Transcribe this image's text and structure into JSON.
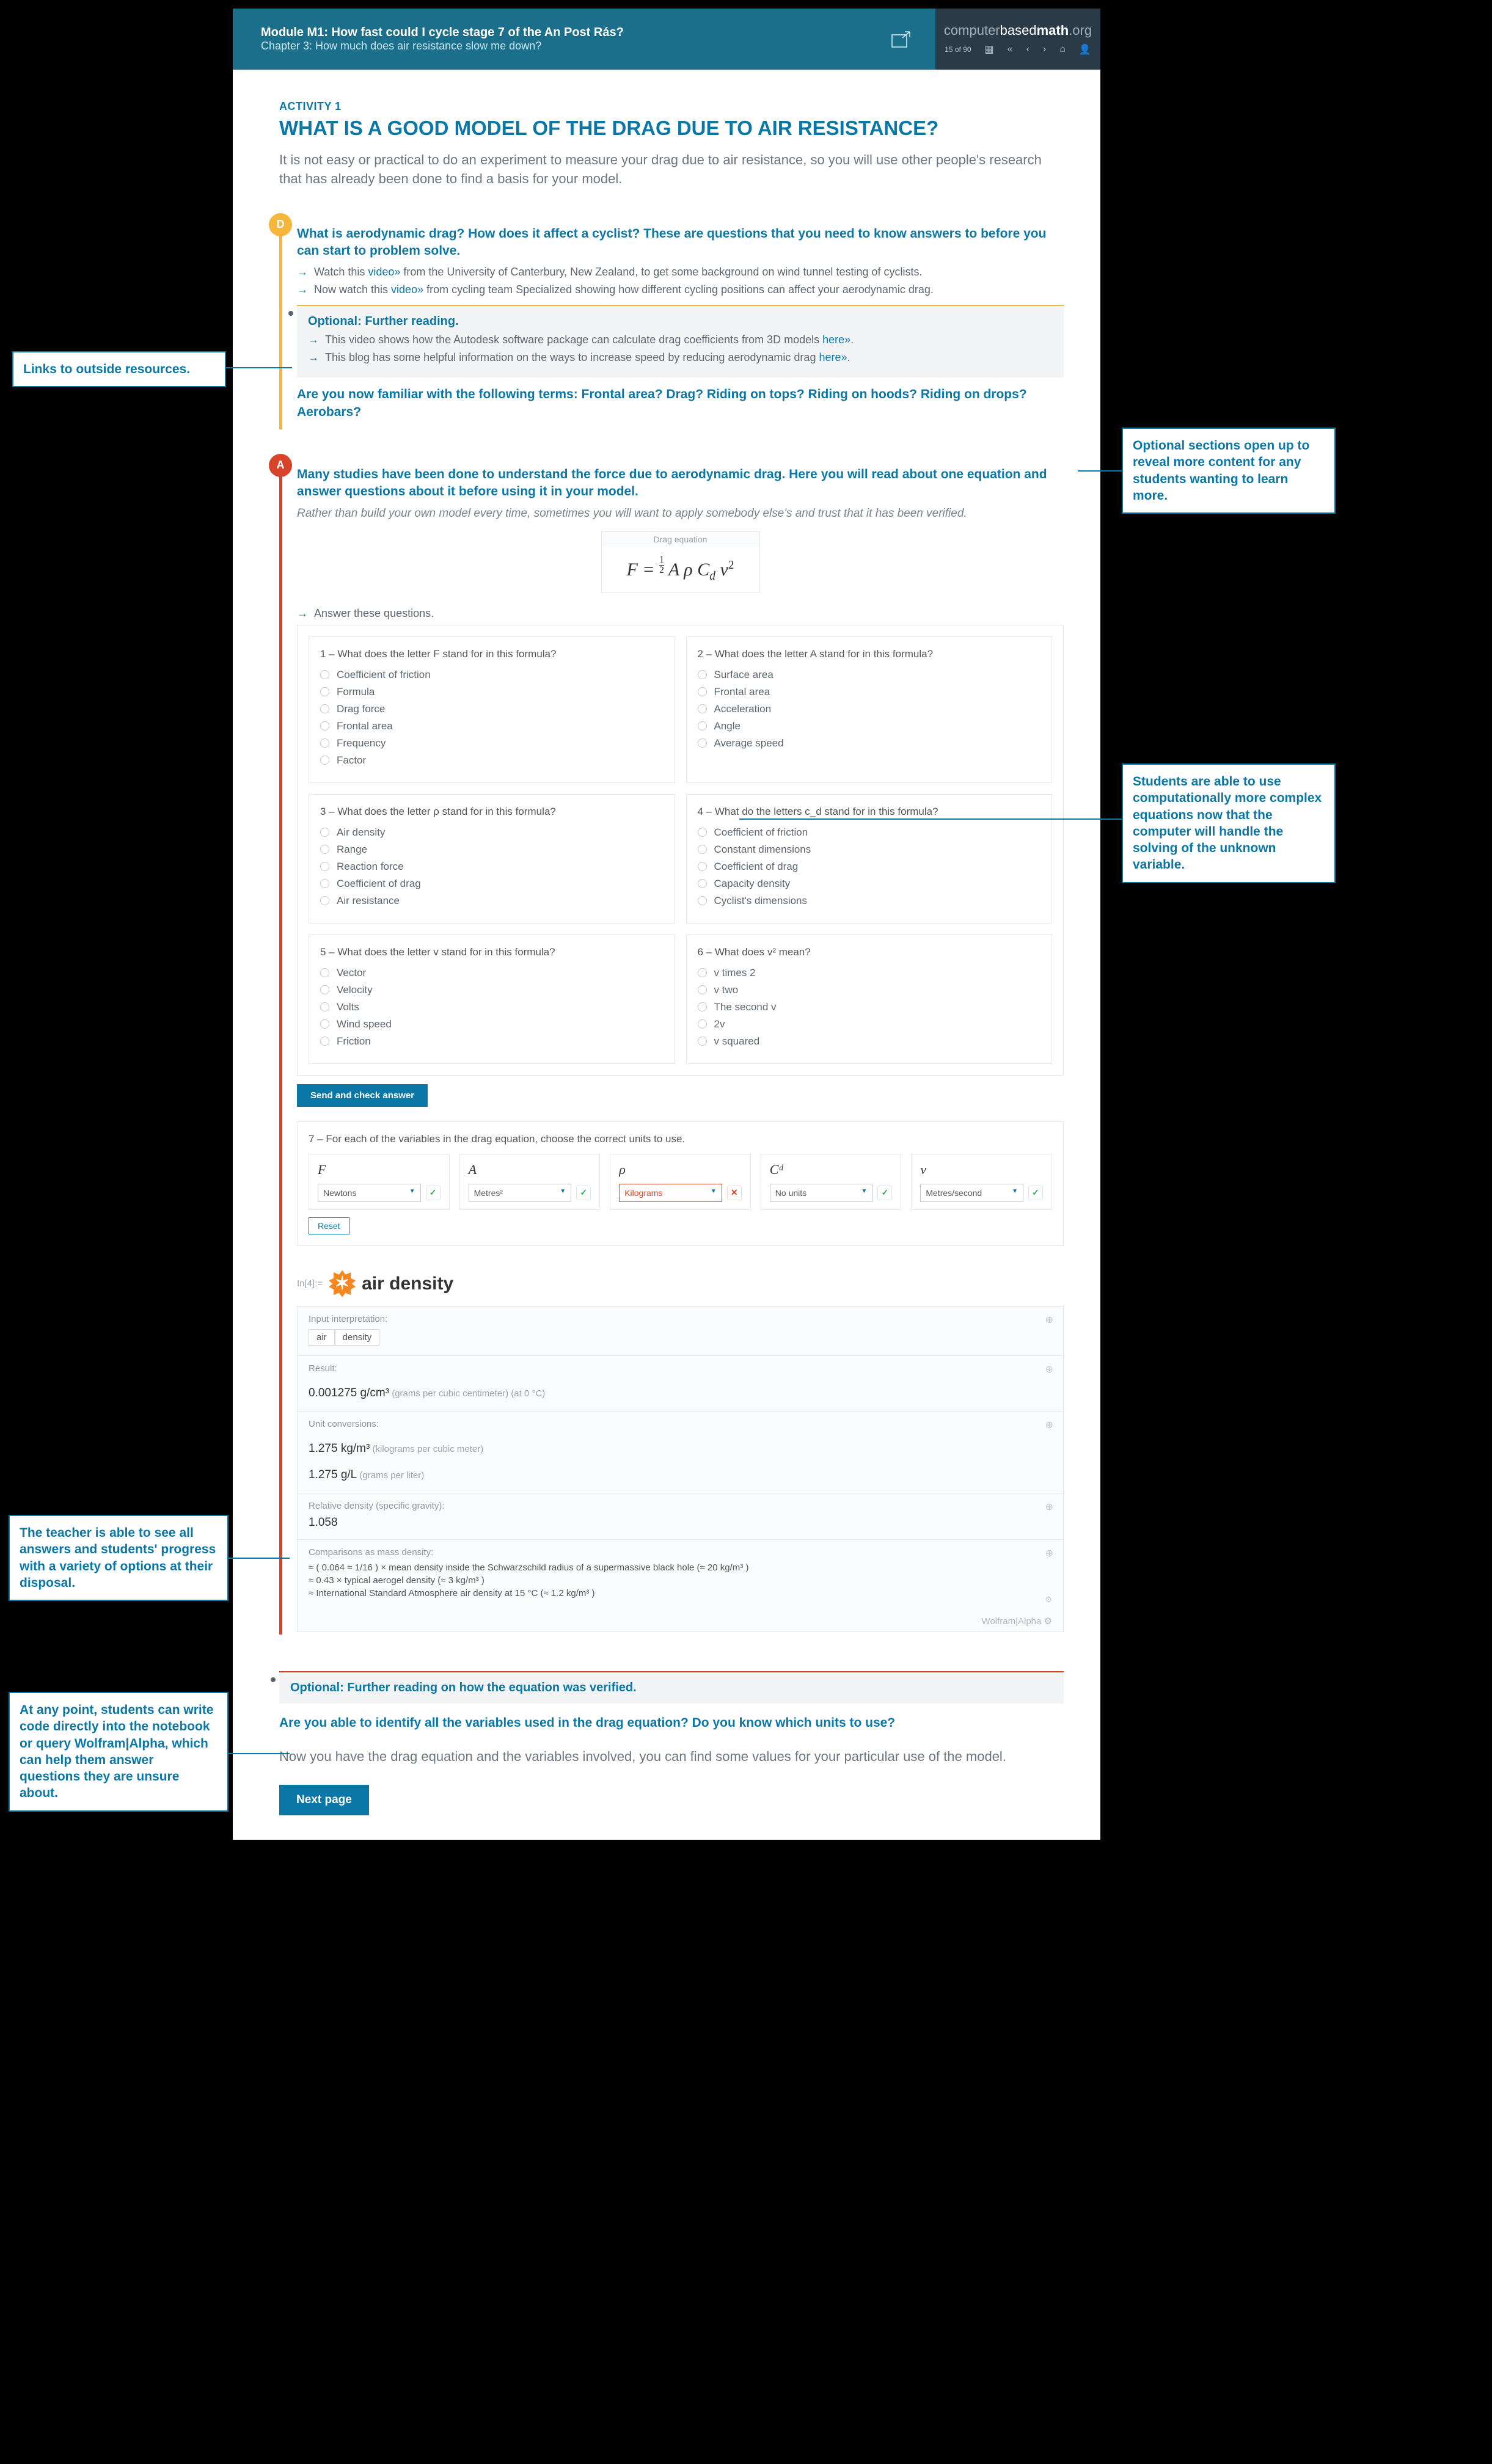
{
  "header": {
    "module": "Module M1: How fast could I cycle stage 7 of the An Post Rás?",
    "chapter": "Chapter 3: How much does air resistance slow me down?",
    "brand_c": "computer",
    "brand_b": "based",
    "brand_m": "math",
    "brand_org": ".org",
    "page_counter": "15 of 90"
  },
  "activity_label": "ACTIVITY 1",
  "title": "WHAT IS A GOOD MODEL OF THE DRAG DUE TO AIR RESISTANCE?",
  "intro": "It is not easy or practical to do an experiment to measure your drag due to air resistance, so you will use other people's research that has already been done to find a basis for your model.",
  "define": {
    "prompt": "What is aerodynamic drag? How does it affect a cyclist? These are questions that you need to know answers to before you can start to problem solve.",
    "line1a": "Watch this ",
    "line1link": "video»",
    "line1b": " from the University of Canterbury, New Zealand, to get some background on wind tunnel testing of cyclists.",
    "line2a": "Now watch this ",
    "line2link": "video»",
    "line2b": " from cycling team Specialized showing how different cycling positions can affect your aerodynamic drag.",
    "opt_title": "Optional: Further reading.",
    "opt1a": "This video shows how the Autodesk software package can calculate drag coefficients from 3D models ",
    "opt1link": "here»",
    "opt2a": "This blog has some helpful information on the ways to increase speed by reducing aerodynamic drag ",
    "opt2link": "here»",
    "followup": "Are you now familiar with the following terms: Frontal area? Drag? Riding on tops? Riding on hoods? Riding on drops? Aerobars?"
  },
  "abstract": {
    "prompt": "Many studies have been done to understand the force due to aerodynamic drag. Here you will read about one equation and answer questions about it before using it in your model.",
    "note": "Rather than build your own model every time, sometimes you will want to apply somebody else's and trust that it has been verified.",
    "eq_head": "Drag equation",
    "answer": "Answer these questions.",
    "q": [
      {
        "t": "1  –  What does the letter F stand for in this formula?",
        "o": [
          "Coefficient of friction",
          "Formula",
          "Drag force",
          "Frontal area",
          "Frequency",
          "Factor"
        ]
      },
      {
        "t": "2  –  What does the letter A stand for in this formula?",
        "o": [
          "Surface area",
          "Frontal area",
          "Acceleration",
          "Angle",
          "Average speed"
        ]
      },
      {
        "t": "3  –  What does the letter ρ stand for in this formula?",
        "o": [
          "Air density",
          "Range",
          "Reaction force",
          "Coefficient of drag",
          "Air resistance"
        ]
      },
      {
        "t": "4  –  What do the letters c_d stand for in this formula?",
        "o": [
          "Coefficient of friction",
          "Constant dimensions",
          "Coefficient of drag",
          "Capacity density",
          "Cyclist's dimensions"
        ]
      },
      {
        "t": "5  –  What does the letter v stand for in this formula?",
        "o": [
          "Vector",
          "Velocity",
          "Volts",
          "Wind speed",
          "Friction"
        ]
      },
      {
        "t": "6  –  What does v² mean?",
        "o": [
          "v times 2",
          "v two",
          "The second v",
          "2v",
          "v squared"
        ]
      }
    ],
    "send": "Send and check answer",
    "q7": {
      "t": "7  –  For each of the variables in the drag equation, choose the correct units to use.",
      "cols": [
        {
          "sym": "F",
          "val": "Newtons",
          "ok": true
        },
        {
          "sym": "A",
          "val": "Metres²",
          "ok": true
        },
        {
          "sym": "ρ",
          "val": "Kilograms",
          "ok": false
        },
        {
          "sym": "Cᵈ",
          "val": "No units",
          "ok": true
        },
        {
          "sym": "v",
          "val": "Metres/second",
          "ok": true
        }
      ],
      "reset": "Reset"
    }
  },
  "wa": {
    "in_prefix": "In[4]:=",
    "query": "air density",
    "sec_input": "Input interpretation:",
    "box1": "air",
    "box2": "density",
    "sec_result": "Result:",
    "result_val": "0.001275 g/cm³",
    "result_note": "  (grams per cubic centimeter)   (at 0 °C)",
    "sec_unit": "Unit conversions:",
    "unit1": "1.275 kg/m³",
    "unit1n": "  (kilograms per cubic meter)",
    "unit2": "1.275 g/L",
    "unit2n": "  (grams per liter)",
    "sec_rel": "Relative density (specific gravity):",
    "rel": "1.058",
    "sec_comp": "Comparisons as mass density:",
    "comp1": "≈ ( 0.064 ≈ 1/16 ) × mean density inside the Schwarzschild radius of a supermassive black hole (≈ 20 kg/m³ )",
    "comp2": "≈ 0.43 × typical aerogel density (≈ 3 kg/m³ )",
    "comp3": "≈ International Standard Atmosphere air density at 15 °C (≈ 1.2 kg/m³ )",
    "footer": "Wolfram|Alpha"
  },
  "outro": {
    "opt_title": "Optional: Further reading on how the equation was verified.",
    "q": "Are you able to identify all the variables used in the drag equation? Do you know which units to use?",
    "closing": "Now you have the drag equation and the variables involved, you can find some values for your particular use of the model.",
    "next": "Next page"
  },
  "callouts": {
    "c1": "Links to outside resources.",
    "c2": "Optional sections open up to reveal more content for any students wanting to learn more.",
    "c3": "Students are able to use computationally more complex equations now that the computer will handle the solving of the unknown variable.",
    "c4": "The teacher is able to see all answers and students' progress with a variety of options at their disposal.",
    "c5": "At any point, students can write code directly into the notebook or query Wolfram|Alpha, which can help them answer questions they are unsure about."
  }
}
